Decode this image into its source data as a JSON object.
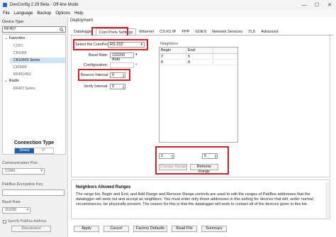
{
  "window": {
    "title": "DevConfig 2.29 Beta - Off-line Mode",
    "minimize": "—",
    "maximize": "☐",
    "close": "✕"
  },
  "menu": [
    "File",
    "Language",
    "Backup",
    "Options",
    "Help"
  ],
  "left": {
    "device_type_label": "Device Type",
    "search_value": "RF407",
    "favorites_label": "Favorites",
    "favorites": [
      "CCFC",
      "CR1000",
      "CR1000X Series",
      "CR3000",
      "RF451/452"
    ],
    "selected_favorite": "CR1000X Series",
    "radio_label": "Radio",
    "radio_items": [
      "RF407 Series"
    ],
    "connection_type_title": "Connection Type",
    "conn_direct": "Direct",
    "conn_ip": "IP",
    "comm_port_label": "Communication Port",
    "comm_port_value": "COM3",
    "encryption_label": "PakBus Encryption Key",
    "baud_rate_label": "Baud Rate",
    "baud_rate_value": "115200",
    "specify_address_label": "Specify PakBus Address",
    "disconnect_label": "Disconnect"
  },
  "main": {
    "deployment_label": "Deployment",
    "tabs": [
      "Datalogger",
      "Com Ports Settings",
      "Ethernet",
      "CS I/O IP",
      "PPP",
      "GOES",
      "Network Services",
      "TLS",
      "Advanced"
    ],
    "active_tab": "Com Ports Settings",
    "select_comport_label": "Select the ComPort:",
    "select_comport_value": "RS-232",
    "baud_rate_label": "Baud Rate:",
    "baud_rate_value": "115200 Auto",
    "configuration_label": "Configuration:",
    "configuration_value": "",
    "beacon_interval_label": "Beacon Interval:",
    "beacon_interval_value": "0",
    "verify_interval_label": "Verify Interval:",
    "verify_interval_value": "0",
    "neighbors_label": "Neighbors",
    "neighbors_headers": [
      "Begin",
      "End"
    ],
    "neighbors_rows": [
      [
        "2",
        "5"
      ],
      [
        "8",
        "8"
      ]
    ],
    "range_begin": "2",
    "range_end": "5",
    "change_range_label": "Change Range",
    "remove_range_label": "Remove Range"
  },
  "help": {
    "title": "Neighbors Allowed Ranges",
    "body": "The range list, Begin and End, and Add Range and Remove Range controls are used to edit the ranges of PakBus addresses that the datalogger will seek out and accept as neighbors. You must enter only those addresses in this setting for devices that will, under normal circumstances, be physically present. The reason for this is that the datalogger will seek to contact all of the devices given in this list."
  },
  "footer": {
    "apply": "Apply",
    "cancel": "Cancel",
    "factory_defaults": "Factory Defaults",
    "read_file": "Read File",
    "summary": "Summary"
  },
  "colors": {
    "highlight_box": "#d0202a",
    "selected_item": "#cfe3f7",
    "direct_active": "#1f5fa8"
  }
}
